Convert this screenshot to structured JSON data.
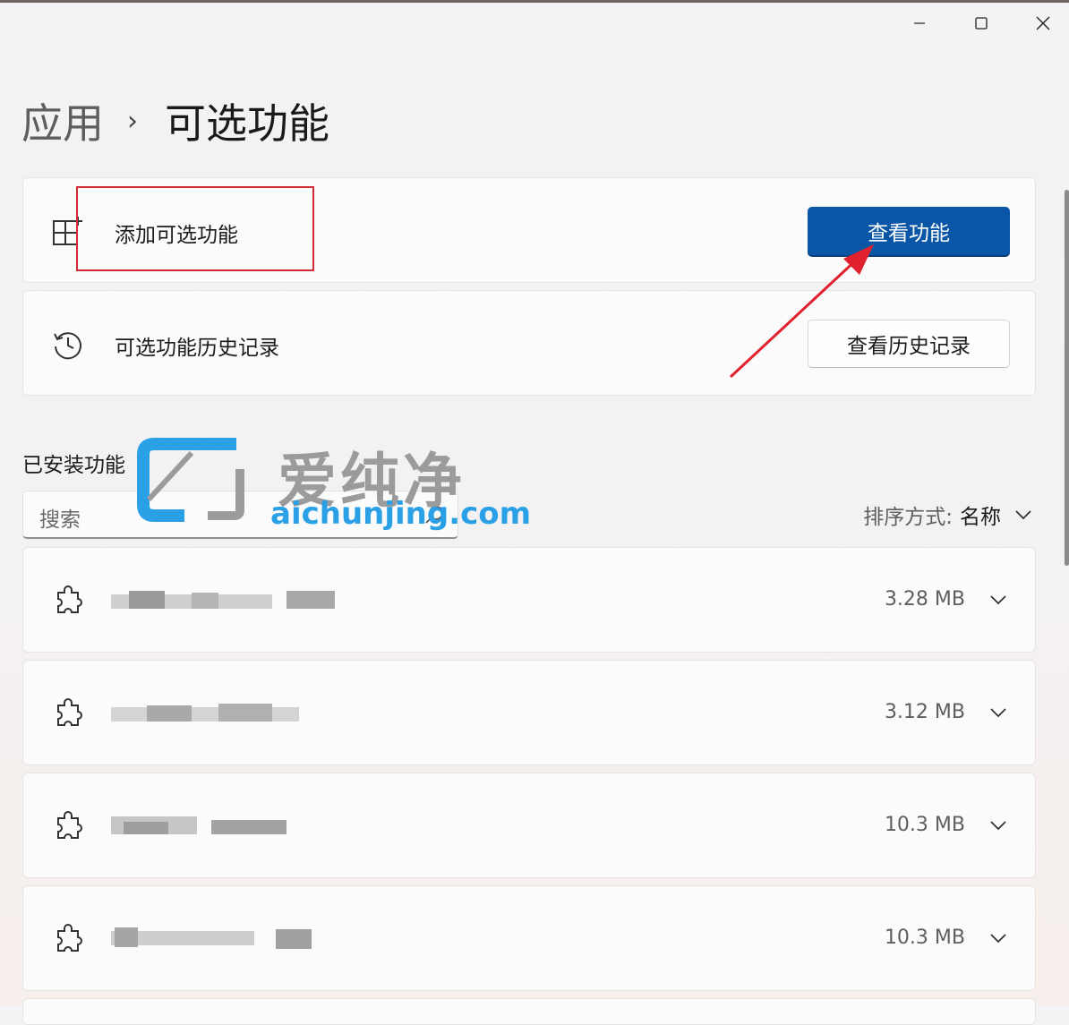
{
  "window": {
    "minimize_icon": "minimize-icon",
    "maximize_icon": "maximize-icon",
    "close_icon": "close-icon"
  },
  "breadcrumb": {
    "parent": "应用",
    "separator": "›",
    "current": "可选功能"
  },
  "add_card": {
    "icon": "add-features-icon",
    "label": "添加可选功能",
    "button": "查看功能"
  },
  "history_card": {
    "icon": "history-icon",
    "label": "可选功能历史记录",
    "button": "查看历史记录"
  },
  "installed": {
    "title": "已安装功能",
    "search_placeholder": "搜索",
    "sort_label": "排序方式:",
    "sort_value": "名称",
    "items": [
      {
        "size": "3.28 MB"
      },
      {
        "size": "3.12 MB"
      },
      {
        "size": "10.3 MB"
      },
      {
        "size": "10.3 MB"
      }
    ]
  },
  "watermark": {
    "cn": "爱纯净",
    "en": "aichunjing.com"
  },
  "colors": {
    "accent": "#0a56a6",
    "highlight": "#d22b36",
    "arrow": "#e0222e"
  }
}
